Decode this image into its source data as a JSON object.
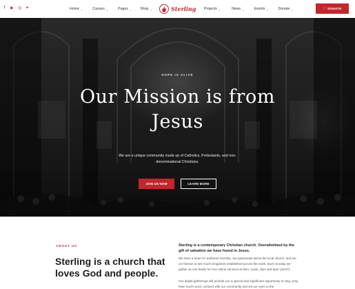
{
  "header": {
    "social_icons": [
      "facebook-icon",
      "youtube-icon",
      "instagram-icon",
      "twitter-icon"
    ],
    "nav_left": [
      "Home",
      "Causes",
      "Pages",
      "Shop"
    ],
    "nav_right": [
      "Projects",
      "News",
      "Events",
      "Donate"
    ],
    "logo_text": "Sterling",
    "donate_button": "DONATE",
    "accent_color": "#c0282d"
  },
  "hero": {
    "kicker": "HOPE IS ALIVE",
    "headline_line1": "Our Mission is from",
    "headline_line2": "Jesus",
    "subtext": "We are a unique community made up of Catholics, Protestants, and non-denominational Christians.",
    "primary_button": "JOIN US NOW",
    "secondary_button": "LEARN MORE"
  },
  "about": {
    "kicker": "ABOUT US",
    "title": "Sterling is a church that loves God and people.",
    "lead": "Sterling is a contemporary Christian church. Overwhelmed by the gift of salvation we have found in Jesus.",
    "paragraph1": "We have a heart for authentic worship, are passionate about the local church, and are on mission to see God's kingdome established across the earth. Each Sunday we gather as one family for four online services at 9am, 11am, 3pm and 6pm (AEST).",
    "paragraph2": "Our digital gatherings will provide you a special and significant opportunity to sing, pray, hear God's word, connect with our community and set our eyes to the"
  }
}
